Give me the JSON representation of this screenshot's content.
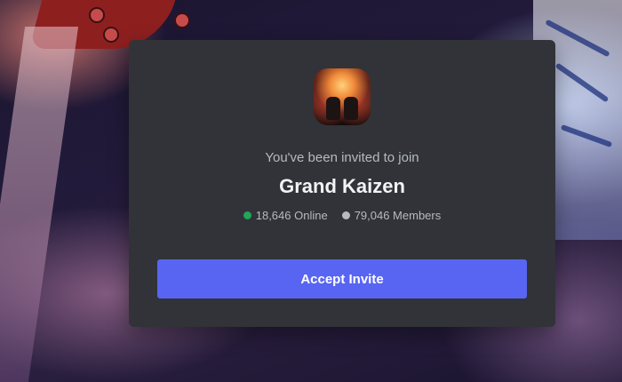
{
  "invite": {
    "subtitle": "You've been invited to join",
    "server_name": "Grand Kaizen",
    "server_icon": "server-icon",
    "online_count": "18,646 Online",
    "member_count": "79,046 Members",
    "accept_label": "Accept Invite"
  },
  "colors": {
    "card_bg": "#313338",
    "accent": "#5865f2",
    "online_dot": "#23a55a",
    "members_dot": "#b5bac1"
  }
}
